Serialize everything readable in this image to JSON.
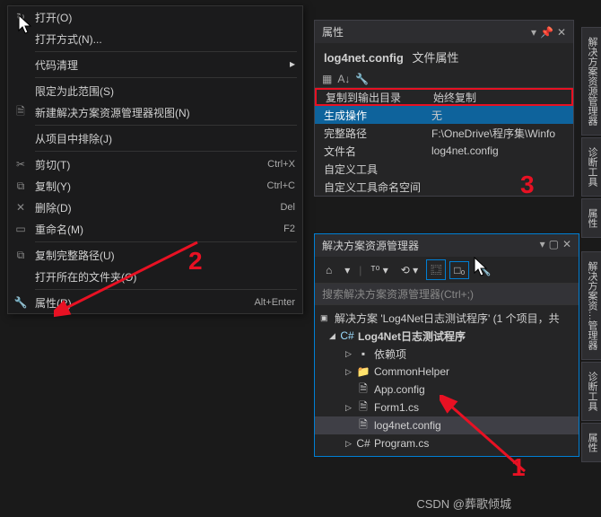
{
  "context_menu": {
    "items": [
      {
        "icon": "↻",
        "label": "打开(O)",
        "shortcut": ""
      },
      {
        "icon": "",
        "label": "打开方式(N)...",
        "shortcut": ""
      },
      {
        "sep": true
      },
      {
        "icon": "",
        "label": "代码清理",
        "shortcut": "",
        "submenu": true
      },
      {
        "sep": true
      },
      {
        "icon": "",
        "label": "限定为此范围(S)",
        "shortcut": ""
      },
      {
        "icon": "🗎",
        "label": "新建解决方案资源管理器视图(N)",
        "shortcut": ""
      },
      {
        "sep": true
      },
      {
        "icon": "",
        "label": "从项目中排除(J)",
        "shortcut": ""
      },
      {
        "sep": true
      },
      {
        "icon": "✂",
        "label": "剪切(T)",
        "shortcut": "Ctrl+X"
      },
      {
        "icon": "⧉",
        "label": "复制(Y)",
        "shortcut": "Ctrl+C"
      },
      {
        "icon": "✕",
        "label": "删除(D)",
        "shortcut": "Del"
      },
      {
        "icon": "▭",
        "label": "重命名(M)",
        "shortcut": "F2"
      },
      {
        "sep": true
      },
      {
        "icon": "⧉",
        "label": "复制完整路径(U)",
        "shortcut": ""
      },
      {
        "icon": "",
        "label": "打开所在的文件夹(O)",
        "shortcut": ""
      },
      {
        "sep": true
      },
      {
        "icon": "🔧",
        "label": "属性(R)",
        "shortcut": "Alt+Enter"
      }
    ]
  },
  "props": {
    "panel_title": "属性",
    "header_name": "log4net.config",
    "header_type": "文件属性",
    "rows": [
      {
        "k": "复制到输出目录",
        "v": "始终复制",
        "boxed": true
      },
      {
        "k": "生成操作",
        "v": "无",
        "selected": true
      },
      {
        "k": "完整路径",
        "v": "F:\\OneDrive\\程序集\\Winfo"
      },
      {
        "k": "文件名",
        "v": "log4net.config"
      },
      {
        "k": "自定义工具",
        "v": ""
      },
      {
        "k": "自定义工具命名空间",
        "v": ""
      }
    ]
  },
  "solution": {
    "panel_title": "解决方案资源管理器",
    "search_placeholder": "搜索解决方案资源管理器(Ctrl+;)",
    "root": "解决方案 'Log4Net日志测试程序' (1 个项目，共",
    "project": "Log4Net日志测试程序",
    "children": [
      {
        "icon": "▪",
        "label": "依赖项",
        "exp": "▷"
      },
      {
        "icon": "📁",
        "label": "CommonHelper",
        "exp": "▷"
      },
      {
        "icon": "🗎",
        "label": "App.config",
        "exp": ""
      },
      {
        "icon": "🗎",
        "label": "Form1.cs",
        "exp": "▷"
      },
      {
        "icon": "🗎",
        "label": "log4net.config",
        "exp": "",
        "selected": true
      },
      {
        "icon": "C#",
        "label": "Program.cs",
        "exp": "▷"
      }
    ]
  },
  "side_tabs": [
    "解决方案资源管理器",
    "诊断工具",
    "属性",
    "解决方案资…管理器",
    "诊断工具",
    "属性"
  ],
  "annotations": {
    "two": "2",
    "three": "3",
    "one": "1"
  },
  "watermark": "CSDN @葬歌倾城"
}
